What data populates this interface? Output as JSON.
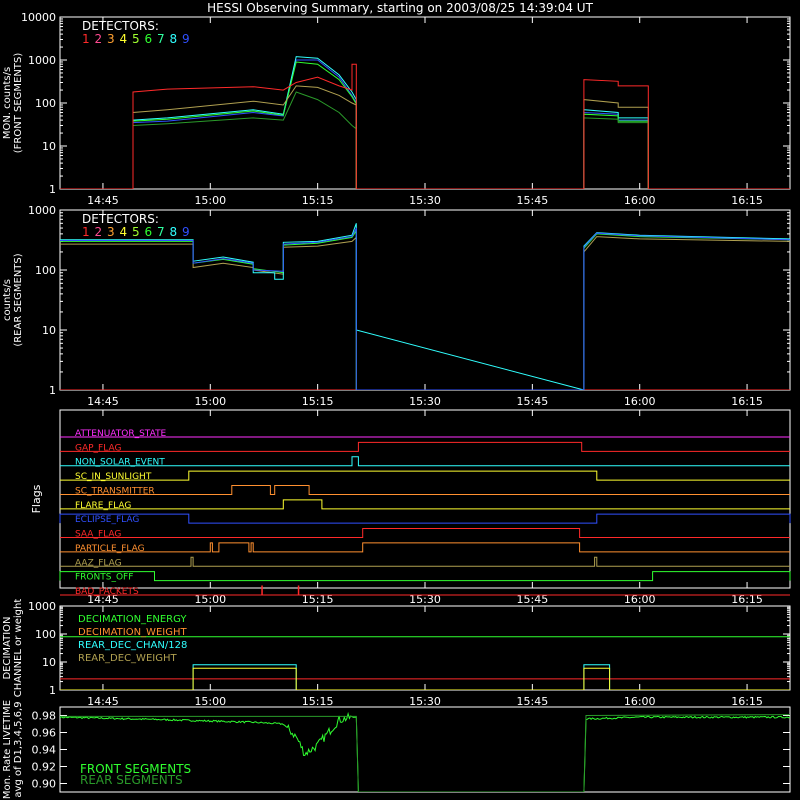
{
  "title": "HESSI Observing Summary, starting on 2003/08/25 14:39:04 UT",
  "colors": {
    "background": "#000000",
    "axis": "#ffffff",
    "det": [
      "#ff2a2a",
      "#ff4a90",
      "#ffa030",
      "#ffff30",
      "#a0ff30",
      "#30ff30",
      "#30ffa0",
      "#30ffff",
      "#3050ff"
    ]
  },
  "chart_data": [
    {
      "type": "line",
      "id": "front",
      "ylabel": "MON. counts/s",
      "ylabel2": "(FRONT SEGMENTS)",
      "scale": "log",
      "ylim": [
        1,
        10000
      ],
      "yticks": [
        1,
        10,
        100,
        1000,
        10000
      ],
      "ytick_labels": [
        "1",
        "10",
        "100",
        "1000",
        "10000"
      ],
      "xlim": [
        14.65,
        16.35
      ],
      "xticks": [
        14.75,
        15.0,
        15.25,
        15.5,
        15.75,
        16.0,
        16.25
      ],
      "xtick_labels": [
        "14:45",
        "15:00",
        "15:15",
        "15:30",
        "15:45",
        "16:00",
        "16:15"
      ],
      "legend_title": "DETECTORS:",
      "legend_entries": [
        "1",
        "2",
        "3",
        "4",
        "5",
        "6",
        "7",
        "8",
        "9"
      ],
      "series": [
        {
          "color": "#3050ff",
          "x": [
            14.65,
            14.82,
            14.82,
            14.9,
            15.1,
            15.17,
            15.2,
            15.25,
            15.3,
            15.33,
            15.34,
            15.34,
            15.87,
            15.87,
            15.95,
            15.95,
            16.02,
            16.02,
            16.35
          ],
          "y": [
            1,
            1,
            35,
            38,
            60,
            50,
            1000,
            1000,
            400,
            150,
            100,
            1,
            1,
            60,
            55,
            40,
            40,
            1,
            1
          ]
        },
        {
          "color": "#30ffff",
          "x": [
            14.65,
            14.82,
            14.82,
            14.9,
            15.1,
            15.17,
            15.2,
            15.25,
            15.3,
            15.33,
            15.34,
            15.34,
            15.87,
            15.87,
            15.95,
            15.95,
            16.02,
            16.02,
            16.35
          ],
          "y": [
            1,
            1,
            40,
            45,
            70,
            55,
            1200,
            1100,
            450,
            180,
            120,
            1,
            1,
            70,
            60,
            45,
            45,
            1,
            1
          ]
        },
        {
          "color": "#30ff30",
          "x": [
            14.65,
            14.82,
            14.82,
            14.9,
            15.1,
            15.17,
            15.2,
            15.25,
            15.3,
            15.33,
            15.34,
            15.34,
            15.87,
            15.87,
            15.95,
            15.95,
            16.02,
            16.02,
            16.35
          ],
          "y": [
            1,
            1,
            38,
            42,
            65,
            52,
            900,
            800,
            350,
            140,
            95,
            1,
            1,
            55,
            50,
            38,
            38,
            1,
            1
          ]
        },
        {
          "color": "#2a9a2a",
          "x": [
            14.65,
            14.82,
            14.82,
            14.9,
            15.1,
            15.17,
            15.2,
            15.25,
            15.3,
            15.33,
            15.34,
            15.34,
            15.87,
            15.87,
            15.95,
            15.95,
            16.02,
            16.02,
            16.35
          ],
          "y": [
            1,
            1,
            30,
            33,
            45,
            40,
            180,
            120,
            60,
            30,
            25,
            1,
            1,
            45,
            42,
            35,
            35,
            1,
            1
          ]
        },
        {
          "color": "#b0a050",
          "x": [
            14.65,
            14.82,
            14.82,
            14.9,
            15.1,
            15.17,
            15.2,
            15.25,
            15.3,
            15.33,
            15.34,
            15.34,
            15.87,
            15.87,
            15.95,
            15.95,
            16.02,
            16.02,
            16.35
          ],
          "y": [
            1,
            1,
            60,
            70,
            110,
            90,
            250,
            230,
            150,
            100,
            90,
            1,
            1,
            120,
            100,
            80,
            80,
            1,
            1
          ]
        },
        {
          "color": "#ff2a2a",
          "x": [
            14.65,
            14.82,
            14.82,
            14.9,
            15.1,
            15.17,
            15.2,
            15.25,
            15.3,
            15.33,
            15.33,
            15.34,
            15.34,
            15.87,
            15.87,
            15.95,
            15.95,
            16.02,
            16.02,
            16.35
          ],
          "y": [
            1,
            1,
            180,
            210,
            240,
            200,
            300,
            400,
            250,
            200,
            800,
            800,
            1,
            1,
            350,
            320,
            250,
            250,
            1,
            1
          ]
        }
      ]
    },
    {
      "type": "line",
      "id": "rear",
      "ylabel": "counts/s",
      "ylabel2": "(REAR SEGMENTS)",
      "scale": "log",
      "ylim": [
        1,
        1000
      ],
      "yticks": [
        1,
        10,
        100,
        1000
      ],
      "ytick_labels": [
        "1",
        "10",
        "100",
        "1000"
      ],
      "xlim": [
        14.65,
        16.35
      ],
      "xticks": [
        14.75,
        15.0,
        15.25,
        15.5,
        15.75,
        16.0,
        16.25
      ],
      "xtick_labels": [
        "14:45",
        "15:00",
        "15:15",
        "15:30",
        "15:45",
        "16:00",
        "16:15"
      ],
      "legend_title": "DETECTORS:",
      "legend_entries": [
        "1",
        "2",
        "3",
        "4",
        "5",
        "6",
        "7",
        "8",
        "9"
      ],
      "series": [
        {
          "color": "#ff2a2a",
          "x": [
            14.65,
            15.34,
            15.34,
            15.87,
            15.87,
            16.35
          ],
          "y": [
            1,
            1,
            1,
            1,
            1,
            1
          ]
        },
        {
          "color": "#b0a050",
          "x": [
            14.65,
            14.96,
            14.96,
            15.03,
            15.1,
            15.1,
            15.17,
            15.17,
            15.25,
            15.33,
            15.34,
            15.34,
            15.87,
            15.87,
            15.9,
            16.0,
            16.35
          ],
          "y": [
            270,
            270,
            110,
            130,
            110,
            100,
            85,
            240,
            250,
            300,
            350,
            1,
            1,
            200,
            360,
            330,
            300
          ]
        },
        {
          "color": "#30ff30",
          "x": [
            14.65,
            14.96,
            14.96,
            15.03,
            15.1,
            15.1,
            15.17,
            15.17,
            15.25,
            15.33,
            15.34,
            15.34,
            15.87,
            15.87,
            15.9,
            16.0,
            16.35
          ],
          "y": [
            300,
            300,
            130,
            150,
            125,
            105,
            90,
            260,
            280,
            350,
            450,
            1,
            1,
            230,
            400,
            360,
            320
          ]
        },
        {
          "color": "#30ffff",
          "x": [
            14.65,
            14.96,
            14.96,
            15.03,
            15.1,
            15.1,
            15.15,
            15.15,
            15.17,
            15.17,
            15.25,
            15.33,
            15.34,
            15.34,
            15.87,
            15.87,
            15.9,
            16.0,
            16.35
          ],
          "y": [
            320,
            320,
            140,
            165,
            135,
            90,
            90,
            70,
            70,
            290,
            300,
            380,
            600,
            10,
            1,
            250,
            420,
            380,
            330
          ]
        },
        {
          "color": "#3050ff",
          "x": [
            14.65,
            14.96,
            14.96,
            15.03,
            15.1,
            15.1,
            15.17,
            15.17,
            15.25,
            15.33,
            15.34,
            15.34,
            15.87,
            15.87,
            15.9,
            16.0,
            16.35
          ],
          "y": [
            310,
            310,
            130,
            155,
            130,
            100,
            95,
            270,
            290,
            360,
            500,
            1,
            1,
            240,
            410,
            370,
            320
          ]
        }
      ]
    },
    {
      "type": "flags",
      "id": "flags",
      "ylabel": "Flags",
      "xlim": [
        14.65,
        16.35
      ],
      "xticks": [
        14.75,
        15.0,
        15.25,
        15.5,
        15.75,
        16.0,
        16.25
      ],
      "xtick_labels": [
        "14:45",
        "15:00",
        "15:15",
        "15:30",
        "15:45",
        "16:00",
        "16:15"
      ],
      "flags": [
        {
          "label": "ATTENUATOR_STATE",
          "color": "#ff30ff",
          "segments": []
        },
        {
          "label": "GAP_FLAG",
          "color": "#ff2a2a",
          "segments": [
            [
              15.345,
              15.865
            ]
          ]
        },
        {
          "label": "NON_SOLAR_EVENT",
          "color": "#30ffff",
          "segments": [
            [
              15.33,
              15.345
            ]
          ]
        },
        {
          "label": "SC_IN_SUNLIGHT",
          "color": "#ffff30",
          "segments": [
            [
              14.95,
              15.9
            ]
          ]
        },
        {
          "label": "SC_TRANSMITTER",
          "color": "#ff9030",
          "segments": [
            [
              15.05,
              15.14
            ],
            [
              15.15,
              15.23
            ]
          ]
        },
        {
          "label": "FLARE_FLAG",
          "color": "#ffff30",
          "segments": [
            [
              15.17,
              15.26
            ]
          ]
        },
        {
          "label": "ECLIPSE_FLAG",
          "color": "#3050ff",
          "segments": [
            [
              14.65,
              14.95
            ],
            [
              15.9,
              16.35
            ]
          ]
        },
        {
          "label": "SAA_FLAG",
          "color": "#ff2a2a",
          "segments": [
            [
              15.355,
              15.86
            ]
          ]
        },
        {
          "label": "PARTICLE_FLAG",
          "color": "#ff9030",
          "segments": [
            [
              15.0,
              15.005
            ],
            [
              15.02,
              15.09
            ],
            [
              15.095,
              15.1
            ],
            [
              15.355,
              15.86
            ]
          ]
        },
        {
          "label": "AAZ_FLAG",
          "color": "#b0a050",
          "segments": [
            [
              14.955,
              14.96
            ],
            [
              15.895,
              15.9
            ]
          ]
        },
        {
          "label": "FRONTS_OFF",
          "color": "#30ff30",
          "segments": [
            [
              14.65,
              14.87
            ],
            [
              16.03,
              16.35
            ]
          ]
        },
        {
          "label": "BAD_PACKETS",
          "color": "#ff2a2a",
          "segments": [
            [
              15.12,
              15.121
            ],
            [
              15.205,
              15.206
            ]
          ]
        }
      ]
    },
    {
      "type": "line",
      "id": "decimation",
      "ylabel": "DECIMATION",
      "ylabel2": "CHANNEL or weight",
      "scale": "log",
      "ylim": [
        1,
        1000
      ],
      "yticks": [
        1,
        10,
        100,
        1000
      ],
      "ytick_labels": [
        "1",
        "10",
        "100",
        "1000"
      ],
      "xlim": [
        14.65,
        16.35
      ],
      "xticks": [
        14.75,
        15.0,
        15.25,
        15.5,
        15.75,
        16.0,
        16.25
      ],
      "xtick_labels": [
        "14:45",
        "15:00",
        "15:15",
        "15:30",
        "15:45",
        "16:00",
        "16:15"
      ],
      "legend_entries": [
        {
          "text": "DECIMATION_ENERGY",
          "color": "#30ff30"
        },
        {
          "text": "DECIMATION_WEIGHT",
          "color": "#ff9030"
        },
        {
          "text": "REAR_DEC_CHAN/128",
          "color": "#30ffff"
        },
        {
          "text": "REAR_DEC_WEIGHT",
          "color": "#b0a050"
        }
      ],
      "series": [
        {
          "color": "#30ff30",
          "x": [
            14.65,
            16.35
          ],
          "y": [
            80,
            80
          ]
        },
        {
          "color": "#ff2a2a",
          "x": [
            14.65,
            16.35
          ],
          "y": [
            2.5,
            2.5
          ]
        },
        {
          "color": "#30ffff",
          "x": [
            14.65,
            14.96,
            14.96,
            15.2,
            15.2,
            15.87,
            15.87,
            15.93,
            15.93,
            16.35
          ],
          "y": [
            1,
            1,
            8,
            8,
            1,
            1,
            8,
            8,
            1,
            1
          ]
        },
        {
          "color": "#ffff30",
          "x": [
            14.65,
            14.96,
            14.96,
            15.2,
            15.2,
            15.87,
            15.87,
            15.93,
            15.93,
            16.35
          ],
          "y": [
            1,
            1,
            6,
            6,
            1,
            1,
            6,
            6,
            1,
            1
          ]
        }
      ]
    },
    {
      "type": "line",
      "id": "livetime",
      "ylabel": "Mon. Rate LIVETIME",
      "ylabel2": "avg of D1,3,4,5,6,9",
      "scale": "linear",
      "ylim": [
        0.89,
        0.99
      ],
      "yticks": [
        0.9,
        0.92,
        0.94,
        0.96,
        0.98
      ],
      "ytick_labels": [
        "0.90",
        "0.92",
        "0.94",
        "0.96",
        "0.98"
      ],
      "xlim": [
        14.65,
        16.35
      ],
      "legend_entries": [
        {
          "text": "FRONT SEGMENTS",
          "color": "#30ff30"
        },
        {
          "text": "REAR SEGMENTS",
          "color": "#2a9a2a"
        }
      ],
      "series": [
        {
          "color": "#30ff30",
          "noise": 0.002,
          "x": [
            14.65,
            14.9,
            15.1,
            15.17,
            15.2,
            15.22,
            15.25,
            15.3,
            15.33,
            15.34,
            15.345,
            15.87,
            15.875,
            16.0,
            16.35
          ],
          "y": [
            0.978,
            0.975,
            0.972,
            0.97,
            0.955,
            0.935,
            0.945,
            0.975,
            0.978,
            0.978,
            0.89,
            0.89,
            0.976,
            0.978,
            0.978
          ]
        },
        {
          "color": "#2a9a2a",
          "noise": 0.0,
          "x": [
            14.65,
            15.34,
            15.345,
            15.87,
            15.875,
            16.35
          ],
          "y": [
            0.979,
            0.979,
            0.89,
            0.89,
            0.98,
            0.981
          ]
        }
      ]
    }
  ]
}
